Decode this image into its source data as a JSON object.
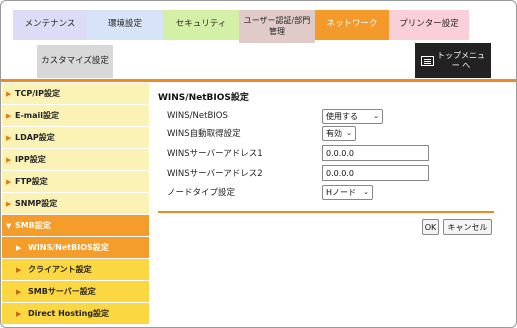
{
  "tabs": {
    "maintenance": "メンテナンス",
    "environment": "環境設定",
    "security": "セキュリティ",
    "auth_line1": "ユーザー認証/部門",
    "auth_line2": "管理",
    "network": "ネットワーク",
    "printer": "プリンター設定",
    "customize": "カスタマイズ設定"
  },
  "top_menu": {
    "line1": "トップメニュ",
    "line2": "ー へ",
    "icon": "menu-list-icon"
  },
  "sidebar": {
    "items": [
      {
        "label": "TCP/IP設定"
      },
      {
        "label": "E-mail設定"
      },
      {
        "label": "LDAP設定"
      },
      {
        "label": "IPP設定"
      },
      {
        "label": "FTP設定"
      },
      {
        "label": "SNMP設定"
      },
      {
        "label": "SMB設定"
      }
    ],
    "sub_items": [
      {
        "label": "WINS/NetBIOS設定"
      },
      {
        "label": "クライアント設定"
      },
      {
        "label": "SMBサーバー設定"
      },
      {
        "label": "Direct Hosting設定"
      }
    ]
  },
  "main": {
    "title": "WINS/NetBIOS設定",
    "fields": {
      "netbios_label": "WINS/NetBIOS",
      "netbios_value": "使用する",
      "auto_label": "WINS自動取得設定",
      "auto_value": "有効",
      "server1_label": "WINSサーバーアドレス1",
      "server1_value": "0.0.0.0",
      "server2_label": "WINSサーバーアドレス2",
      "server2_value": "0.0.0.0",
      "node_label": "ノードタイプ設定",
      "node_value": "Hノード"
    },
    "ok_label": "OK",
    "cancel_label": "キャンセル"
  },
  "colors": {
    "accent": "#f08a1c",
    "sidebar_bg": "#fbf2b6",
    "sidebar_sub_bg": "#fbd842"
  }
}
